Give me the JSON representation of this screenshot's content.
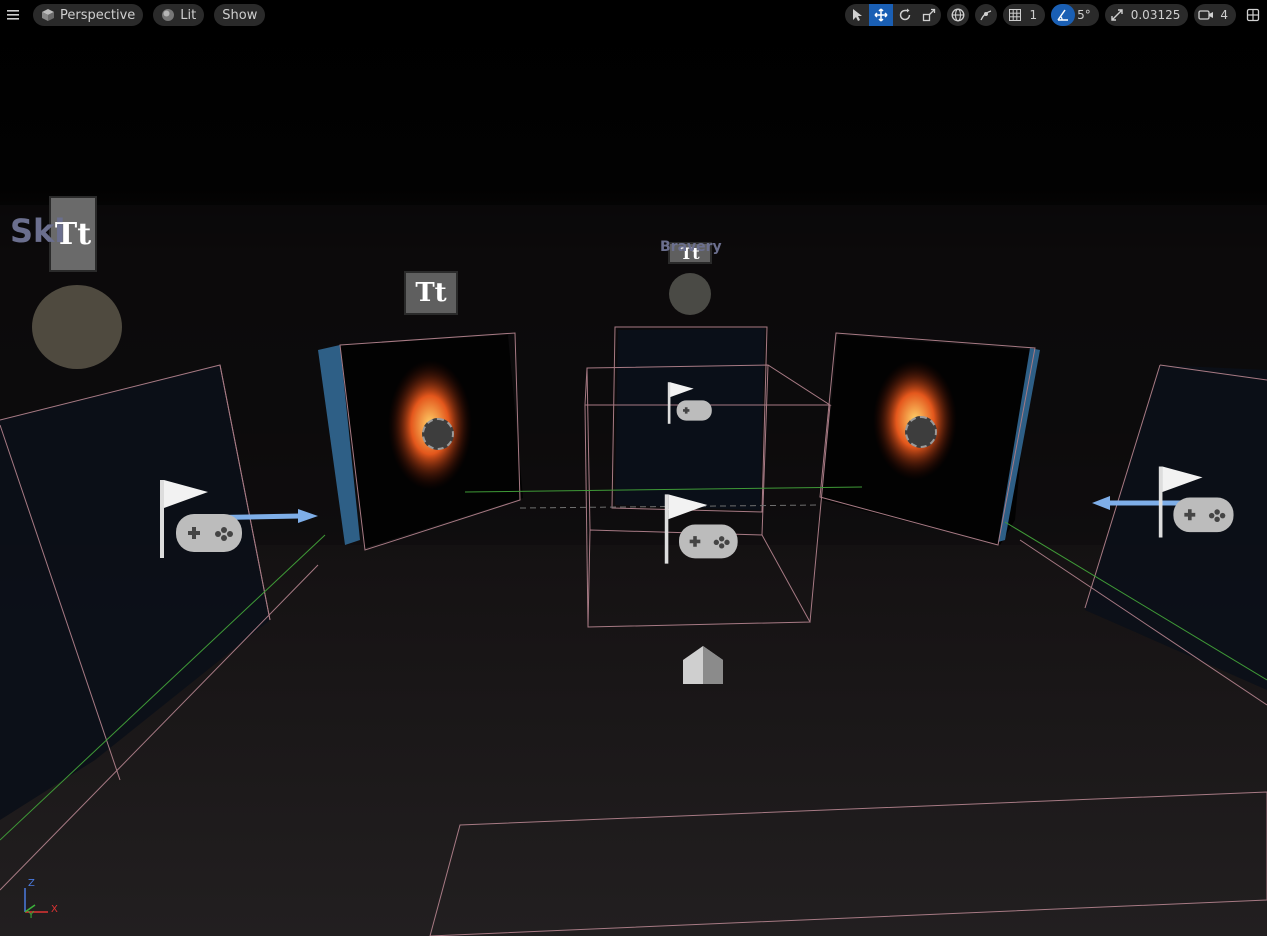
{
  "toolbar": {
    "menu_icon": "hamburger-icon",
    "view_mode": "Perspective",
    "lighting_mode": "Lit",
    "show_label": "Show",
    "grid_snap_value": "1",
    "rotation_snap_value": "5°",
    "scale_snap_value": "0.03125",
    "camera_speed_value": "4",
    "transform_tools": [
      "select-icon",
      "translate-icon",
      "rotate-icon",
      "scale-icon"
    ],
    "accent_color": "#1a5fb4"
  },
  "scene": {
    "text_labels": [
      "Ski",
      "Bravery"
    ],
    "text_render_glyph": "Tt",
    "axis_gizmo": {
      "x": "X",
      "y": "Y",
      "z": "Z"
    },
    "colors": {
      "bounds_wire": "#a77a84",
      "green_line": "#3f9a37",
      "blue_arrow": "#7eaee8",
      "panel_blue": "#2e5f86"
    }
  }
}
